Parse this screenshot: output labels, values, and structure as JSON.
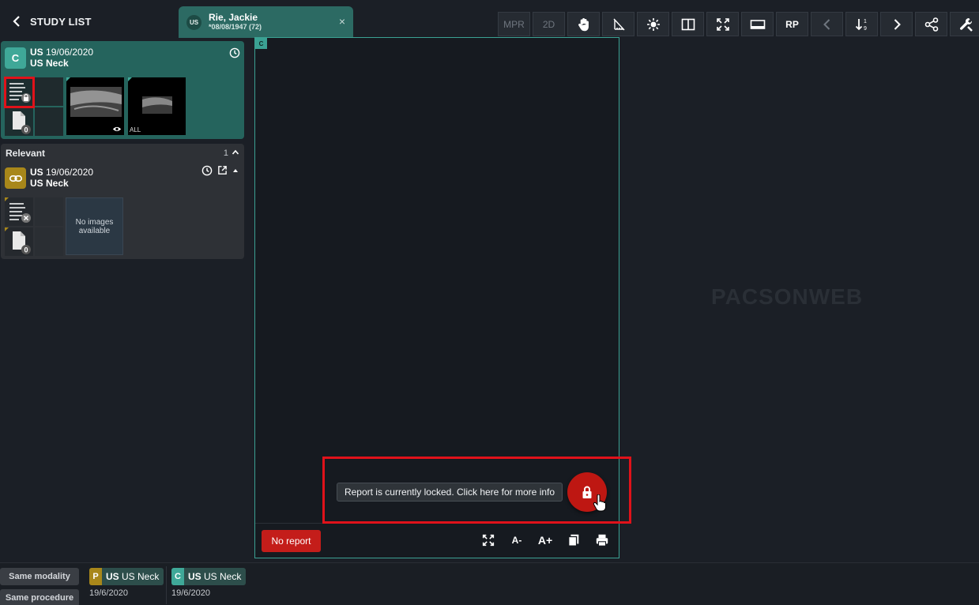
{
  "header": {
    "back_label": "STUDY LIST",
    "patient_tab": {
      "modality": "US",
      "name": "Rie, Jackie",
      "dob": "*08/08/1947 (72)",
      "close": "×"
    },
    "toolbar": {
      "mpr": "MPR",
      "d2": "2D",
      "rp": "RP",
      "sort_numbers": "1\n9"
    }
  },
  "current_study": {
    "badge": "C",
    "modality": "US",
    "date": "19/06/2020",
    "description": "US Neck",
    "doc_count": "0",
    "series_label": "ALL"
  },
  "relevant": {
    "title": "Relevant",
    "count": "1",
    "study": {
      "modality": "US",
      "date": "19/06/2020",
      "description": "US Neck",
      "doc_count": "0",
      "no_images": "No images available"
    }
  },
  "viewer": {
    "corner_label": "C",
    "no_report": "No report",
    "font_decrease": "A-",
    "font_increase": "A+",
    "lock_tooltip": "Report is currently locked. Click here for more info"
  },
  "watermark": "PACSONWEB",
  "bottom": {
    "same_modality": "Same modality",
    "same_procedure": "Same procedure",
    "chips": [
      {
        "badge": "P",
        "modality": "US",
        "description": "US Neck",
        "date": "19/6/2020",
        "color": "#a8871a"
      },
      {
        "badge": "C",
        "modality": "US",
        "description": "US Neck",
        "date": "19/6/2020",
        "color": "#3fa898"
      }
    ]
  },
  "colors": {
    "accent": "#3ba193",
    "danger": "#c41d1a",
    "highlight": "#e0121a"
  }
}
